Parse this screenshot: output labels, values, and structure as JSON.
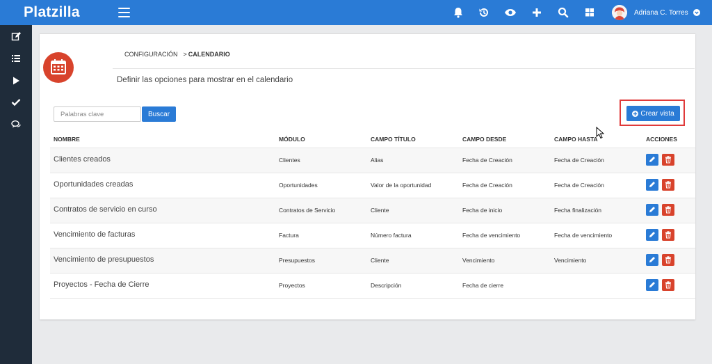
{
  "app": {
    "logo": "Platzilla"
  },
  "topbar": {
    "icons": [
      "bell-icon",
      "history-icon",
      "eye-icon",
      "plus-icon",
      "search-icon",
      "grid-icon"
    ],
    "user_name": "Adriana C. Torres"
  },
  "sidebar": {
    "icons": [
      "edit-icon",
      "list-icon",
      "play-icon",
      "check-icon",
      "chat-icon"
    ]
  },
  "breadcrumb": {
    "parent": "CONFIGURACIÓN",
    "separator": ">",
    "current": "CALENDARIO"
  },
  "description": "Definir las opciones para mostrar en el calendario",
  "search": {
    "placeholder": "Palabras clave",
    "button": "Buscar"
  },
  "create_button": "Crear vista",
  "table": {
    "headers": [
      "NOMBRE",
      "MÓDULO",
      "CAMPO TÍTULO",
      "CAMPO DESDE",
      "CAMPO HASTA",
      "ACCIONES"
    ],
    "rows": [
      [
        "Clientes creados",
        "Clientes",
        "Alias",
        "Fecha de Creación",
        "Fecha de Creación"
      ],
      [
        "Oportunidades creadas",
        "Oportunidades",
        "Valor de la oportunidad",
        "Fecha de Creación",
        "Fecha de Creación"
      ],
      [
        "Contratos de servicio en curso",
        "Contratos de Servicio",
        "Cliente",
        "Fecha de inicio",
        "Fecha finalización"
      ],
      [
        "Vencimiento de facturas",
        "Factura",
        "Número factura",
        "Fecha de vencimiento",
        "Fecha de vencimiento"
      ],
      [
        "Vencimiento de presupuestos",
        "Presupuestos",
        "Cliente",
        "Vencimiento",
        "Vencimiento"
      ],
      [
        "Proyectos - Fecha de Cierre",
        "Proyectos",
        "Descripción",
        "Fecha de cierre",
        ""
      ]
    ]
  },
  "colors": {
    "primary": "#2a7bd6",
    "danger": "#d8432c",
    "sidebar": "#1f2c3a",
    "highlight": "#e03a3a"
  }
}
